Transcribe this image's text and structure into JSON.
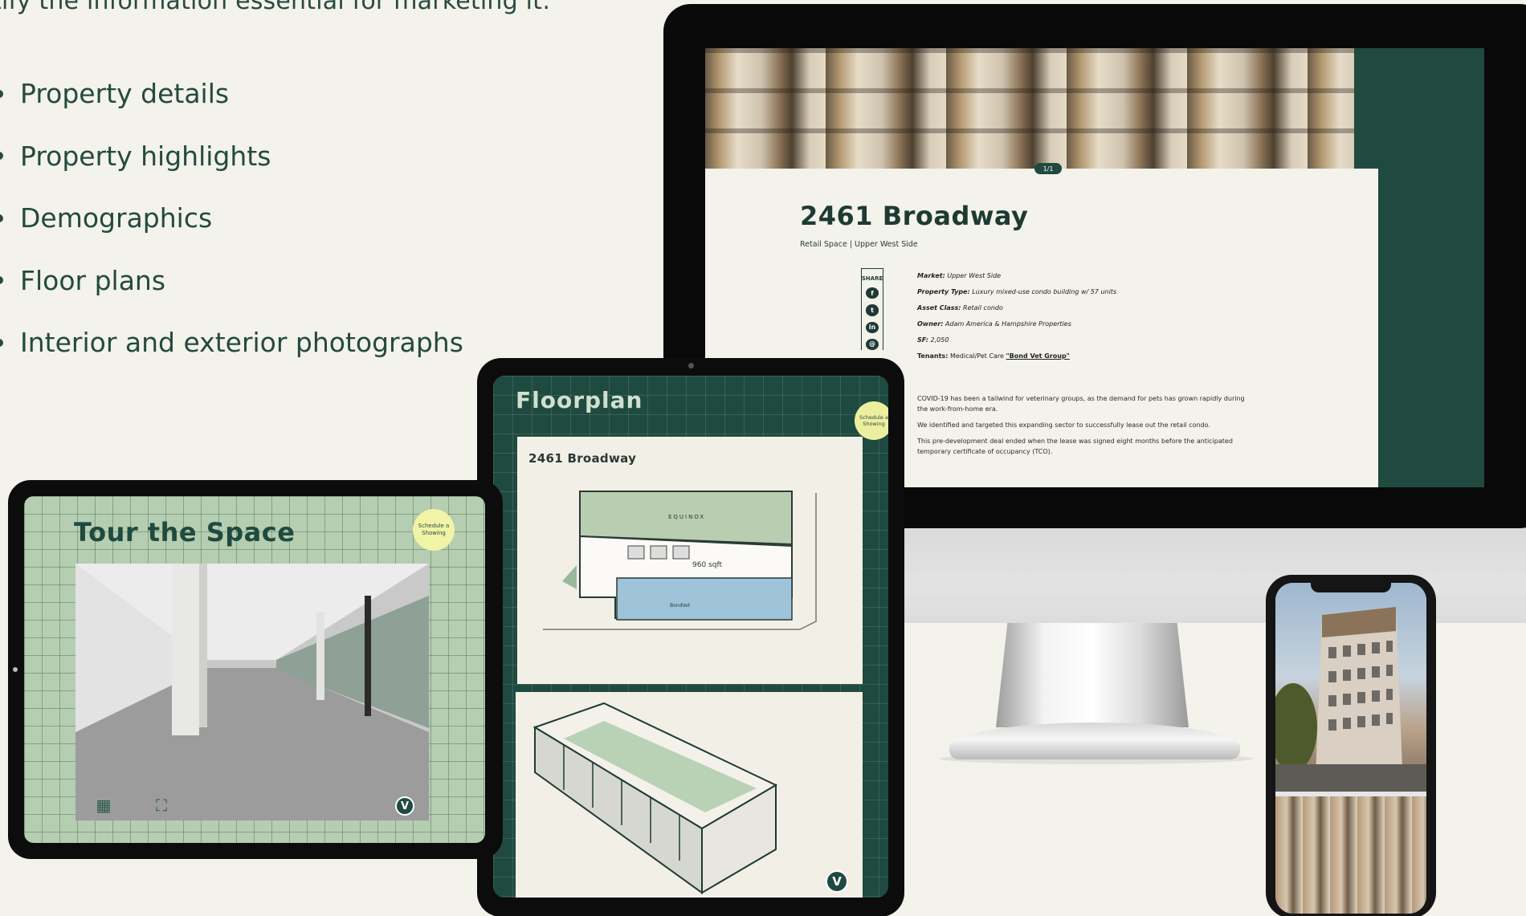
{
  "intro": {
    "text": "tify the information essential for marketing it:"
  },
  "bullets": [
    {
      "label": "Property details"
    },
    {
      "label": "Property highlights"
    },
    {
      "label": "Demographics"
    },
    {
      "label": "Floor plans"
    },
    {
      "label": "Interior and exterior photographs"
    }
  ],
  "listing": {
    "pager": "1/1",
    "title": "2461 Broadway",
    "subtitle": "Retail Space  |  Upper West Side",
    "share_label": "SHARE",
    "share_icons": [
      "facebook-icon",
      "twitter-icon",
      "linkedin-icon",
      "email-icon"
    ],
    "facts": [
      {
        "key": "Market:",
        "value": "Upper West Side"
      },
      {
        "key": "Property Type:",
        "value": "Luxury mixed-use condo building w/ 57 units"
      },
      {
        "key": "Asset Class:",
        "value": "Retail condo"
      },
      {
        "key": "Owner:",
        "value": "Adam America & Hampshire Properties"
      },
      {
        "key": "SF:",
        "value": "2,050"
      }
    ],
    "tenants": {
      "key": "Tenants:",
      "value": "Medical/Pet Care",
      "link": "\"Bond Vet Group\""
    },
    "description": [
      "COVID-19 has been a tailwind for veterinary groups, as the demand for pets has grown rapidly during the work-from-home era.",
      "We identified and targeted this expanding sector to successfully lease out the retail condo.",
      "This pre-development deal ended when the lease was signed eight months before the anticipated temporary certificate of occupancy (TCO)."
    ]
  },
  "floorplan": {
    "heading": "Floorplan",
    "schedule": "Schedule a Showing",
    "card_title": "2461 Broadway",
    "labels": {
      "neighbor": "EQUINOX",
      "area": "960 sqft",
      "tenant": "BondVet"
    },
    "badge": "V"
  },
  "tour": {
    "heading": "Tour the Space",
    "schedule": "Schedule a Showing",
    "icons": [
      "floorplan-icon",
      "fullscreen-icon"
    ],
    "badge": "V"
  },
  "colors": {
    "brand_green": "#1f4a3f",
    "sage": "#b5cdb1",
    "accent_yellow": "#ecef9e",
    "page_bg": "#f3f2eb"
  }
}
